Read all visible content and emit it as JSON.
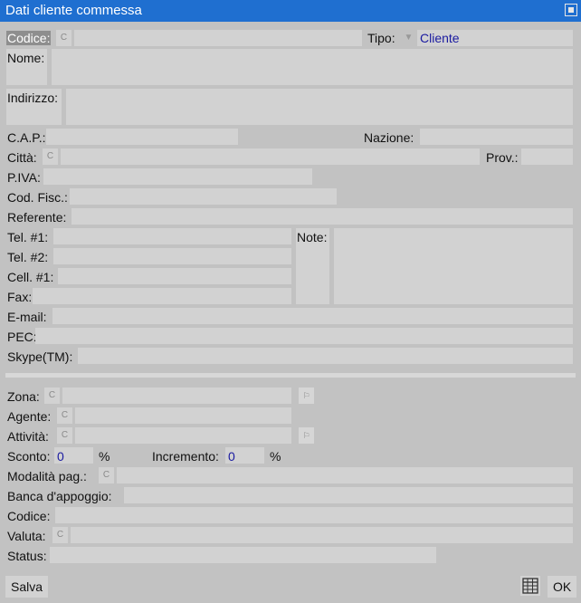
{
  "window": {
    "title": "Dati cliente commessa"
  },
  "fields": {
    "codice": "Codice:",
    "tipo": "Tipo:",
    "tipo_value": "Cliente",
    "nome": "Nome:",
    "indirizzo": "Indirizzo:",
    "cap": "C.A.P.:",
    "nazione": "Nazione:",
    "citta": "Città:",
    "prov": "Prov.:",
    "piva": "P.IVA:",
    "codfisc": "Cod. Fisc.:",
    "referente": "Referente:",
    "tel1": "Tel. #1:",
    "tel2": "Tel. #2:",
    "cell1": "Cell. #1:",
    "fax": "Fax:",
    "note": "Note:",
    "email": "E-mail:",
    "pec": "PEC:",
    "skype": "Skype(TM):",
    "zona": "Zona:",
    "agente": "Agente:",
    "attivita": "Attività:",
    "sconto": "Sconto:",
    "sconto_value": "0",
    "incremento": "Incremento:",
    "incremento_value": "0",
    "percent": "%",
    "modalita": "Modalità pag.:",
    "banca": "Banca d'appoggio:",
    "codice2": "Codice:",
    "valuta": "Valuta:",
    "status": "Status:"
  },
  "glyphs": {
    "lookup": "C",
    "flag": "⚐",
    "dropdown": "▼"
  },
  "buttons": {
    "save": "Salva",
    "ok": "OK"
  },
  "colors": {
    "titlebar": "#1f6fd0",
    "background": "#c2c2c2",
    "field": "#d2d2d2",
    "value": "#1a1aa0"
  }
}
